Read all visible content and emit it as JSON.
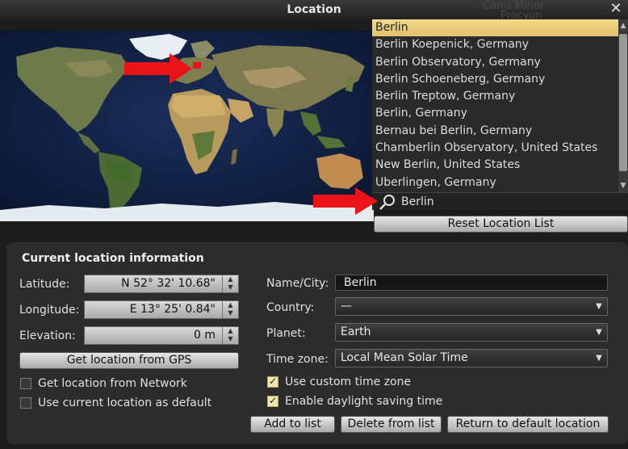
{
  "window": {
    "title": "Location"
  },
  "background": {
    "label_1": "Canis Minor",
    "label_2": "Procyon"
  },
  "city_list": {
    "items": [
      "Berlin",
      "Berlin Koepenick, Germany",
      "Berlin Observatory, Germany",
      "Berlin Schoeneberg, Germany",
      "Berlin Treptow, Germany",
      "Berlin, Germany",
      "Bernau bei Berlin, Germany",
      "Chamberlin Observatory, United States",
      "New Berlin, United States",
      "Uberlingen, Germany"
    ],
    "selected_index": 0
  },
  "search": {
    "value": "Berlin"
  },
  "buttons": {
    "reset_list": "Reset Location List",
    "gps": "Get location from GPS",
    "add": "Add to list",
    "delete": "Delete from list",
    "return_default": "Return to default location"
  },
  "current": {
    "section_title": "Current location information",
    "latitude_label": "Latitude:",
    "latitude_value": "N 52° 32' 10.68\"",
    "longitude_label": "Longitude:",
    "longitude_value": "E 13° 25' 0.84\"",
    "elevation_label": "Elevation:",
    "elevation_value": "0 m",
    "name_label": "Name/City:",
    "name_value": "Berlin",
    "country_label": "Country:",
    "country_value": "—",
    "planet_label": "Planet:",
    "planet_value": "Earth",
    "timezone_label": "Time zone:",
    "timezone_value": "Local Mean Solar Time"
  },
  "options": {
    "network": {
      "label": "Get location from Network",
      "checked": false
    },
    "default": {
      "label": "Use current location as default",
      "checked": false
    },
    "custom_tz": {
      "label": "Use custom time zone",
      "checked": true
    },
    "dst": {
      "label": "Enable daylight saving time",
      "checked": true
    }
  },
  "colors": {
    "selection": "#e9cc75",
    "arrow": "#e8141a",
    "ocean": "#0d1b3a"
  }
}
